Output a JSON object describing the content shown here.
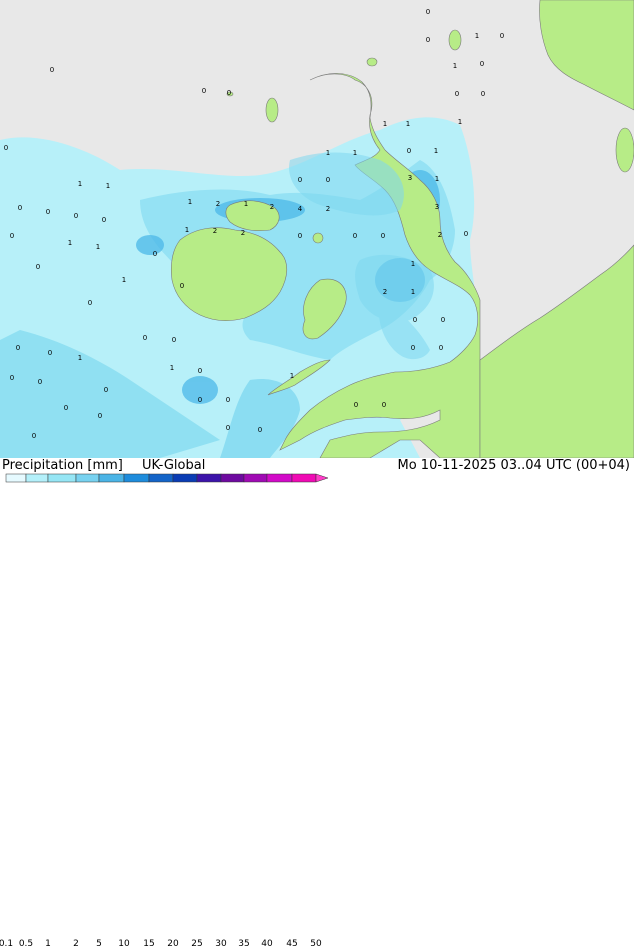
{
  "map": {
    "title": "Precipitation [mm]",
    "model": "UK-Global",
    "valid_time": "Mo 10-11-2025 03..04 UTC (00+04)",
    "colors": {
      "sea": "#e8e8e8",
      "land": "#b7ec87",
      "precip_light": "#b4f0fa",
      "precip_mid": "#7fd8f0",
      "precip_heavy": "#4cb8e8"
    },
    "point_values": [
      {
        "id": "p1",
        "v": "0"
      },
      {
        "id": "p2",
        "v": "1"
      },
      {
        "id": "p3",
        "v": "0"
      },
      {
        "id": "p4",
        "v": "1"
      },
      {
        "id": "p5",
        "v": "0"
      },
      {
        "id": "p6",
        "v": "0"
      },
      {
        "id": "p7",
        "v": "0"
      },
      {
        "id": "p8",
        "v": "0"
      },
      {
        "id": "p9",
        "v": "0"
      },
      {
        "id": "p10",
        "v": "0"
      },
      {
        "id": "p11",
        "v": "0"
      },
      {
        "id": "p12",
        "v": "0"
      },
      {
        "id": "p13",
        "v": "1"
      },
      {
        "id": "p14",
        "v": "1"
      },
      {
        "id": "p15",
        "v": "0"
      },
      {
        "id": "p16",
        "v": "1"
      },
      {
        "id": "p17",
        "v": "0"
      },
      {
        "id": "p18",
        "v": "3"
      },
      {
        "id": "p19",
        "v": "1"
      },
      {
        "id": "p20",
        "v": "0"
      },
      {
        "id": "p21",
        "v": "1"
      },
      {
        "id": "p22",
        "v": "2"
      },
      {
        "id": "p23",
        "v": "1"
      },
      {
        "id": "p24",
        "v": "2"
      },
      {
        "id": "p25",
        "v": "4"
      },
      {
        "id": "p26",
        "v": "2"
      },
      {
        "id": "p27",
        "v": "1"
      },
      {
        "id": "p28",
        "v": "2"
      },
      {
        "id": "p29",
        "v": "2"
      },
      {
        "id": "p30",
        "v": "0"
      },
      {
        "id": "p31",
        "v": "3"
      },
      {
        "id": "p32",
        "v": "2"
      },
      {
        "id": "p33",
        "v": "0"
      },
      {
        "id": "p34",
        "v": "1"
      },
      {
        "id": "p35",
        "v": "2"
      },
      {
        "id": "p36",
        "v": "1"
      },
      {
        "id": "p37",
        "v": "0"
      },
      {
        "id": "p38",
        "v": "0"
      },
      {
        "id": "p39",
        "v": "0"
      },
      {
        "id": "p40",
        "v": "0"
      },
      {
        "id": "p41",
        "v": "0"
      },
      {
        "id": "p42",
        "v": "1"
      },
      {
        "id": "p43",
        "v": "1"
      },
      {
        "id": "p44",
        "v": "0"
      },
      {
        "id": "p45",
        "v": "0"
      },
      {
        "id": "p46",
        "v": "1"
      },
      {
        "id": "p47",
        "v": "0"
      },
      {
        "id": "p48",
        "v": "0"
      },
      {
        "id": "p49",
        "v": "0"
      },
      {
        "id": "p50",
        "v": "0"
      },
      {
        "id": "p51",
        "v": "1"
      },
      {
        "id": "p52",
        "v": "1"
      },
      {
        "id": "p53",
        "v": "0"
      },
      {
        "id": "p54",
        "v": "0"
      },
      {
        "id": "p55",
        "v": "0"
      },
      {
        "id": "p56",
        "v": "0"
      },
      {
        "id": "p57",
        "v": "0"
      },
      {
        "id": "p58",
        "v": "0"
      },
      {
        "id": "p59",
        "v": "0"
      },
      {
        "id": "p60",
        "v": "0"
      },
      {
        "id": "p61",
        "v": "0"
      },
      {
        "id": "p62",
        "v": "0"
      },
      {
        "id": "p63",
        "v": "0"
      },
      {
        "id": "p64",
        "v": "0"
      },
      {
        "id": "p65",
        "v": "0"
      },
      {
        "id": "p66",
        "v": "0"
      },
      {
        "id": "p67",
        "v": "0"
      },
      {
        "id": "p68",
        "v": "0"
      },
      {
        "id": "p69",
        "v": "0"
      },
      {
        "id": "p70",
        "v": "0"
      },
      {
        "id": "p71",
        "v": "0"
      },
      {
        "id": "p72",
        "v": "1"
      },
      {
        "id": "p73",
        "v": "1"
      },
      {
        "id": "p74",
        "v": "1"
      },
      {
        "id": "p75",
        "v": "1"
      },
      {
        "id": "p76",
        "v": "1"
      },
      {
        "id": "p77",
        "v": "0"
      },
      {
        "id": "p78",
        "v": "0"
      },
      {
        "id": "p79",
        "v": "1"
      }
    ]
  },
  "legend": {
    "ticks": [
      "0.1",
      "0.5",
      "1",
      "2",
      "5",
      "10",
      "15",
      "20",
      "25",
      "30",
      "35",
      "40",
      "45",
      "50"
    ],
    "colors": [
      "#e6faff",
      "#b4f0fa",
      "#96e6f5",
      "#78d2f0",
      "#4bb4e6",
      "#1e8cdc",
      "#1464c8",
      "#0a3cb4",
      "#3c14aa",
      "#6e0aa0",
      "#a00ab4",
      "#d20ac8",
      "#f00ab4",
      "#ff3cc8"
    ]
  }
}
